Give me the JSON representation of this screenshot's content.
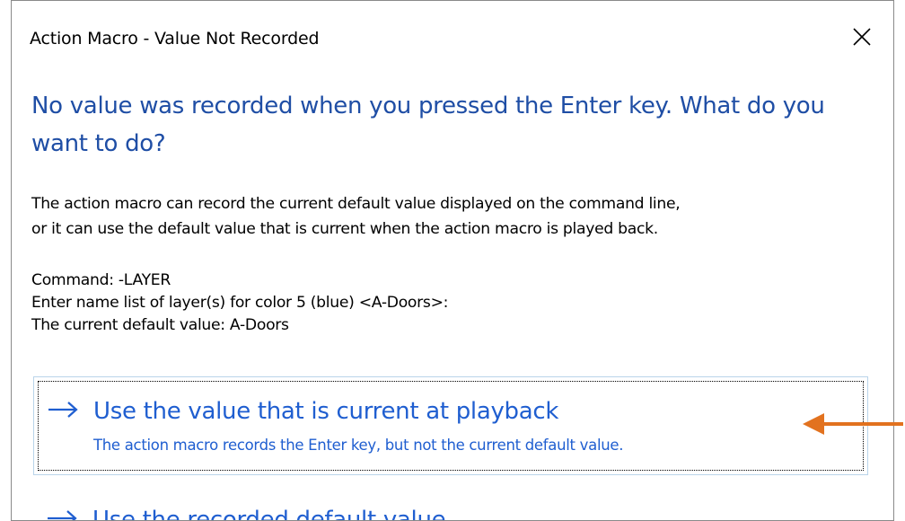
{
  "window": {
    "title": "Action Macro - Value Not Recorded"
  },
  "main": {
    "instruction": "No value was recorded when you pressed the Enter key. What do you want to do?",
    "content_lines": [
      "The action macro can record the current default value displayed on the command line,",
      "or it can use the default value that is current when the action macro is played back."
    ],
    "command_lines": [
      "Command: -LAYER",
      "Enter name list of layer(s) for color 5 (blue) <A-Doors>:",
      "The current default value: A-Doors"
    ]
  },
  "options": [
    {
      "title": "Use the value that is current at playback",
      "note": "The action macro records the Enter key, but not the current default value.",
      "icon": "arrow-right-icon"
    },
    {
      "title": "Use the recorded default value",
      "icon": "arrow-right-icon"
    }
  ],
  "colors": {
    "instruction": "#1f4ea5",
    "link": "#1f5ed0",
    "callout": "#e2721f",
    "hover_border": "#b9d4ea"
  }
}
